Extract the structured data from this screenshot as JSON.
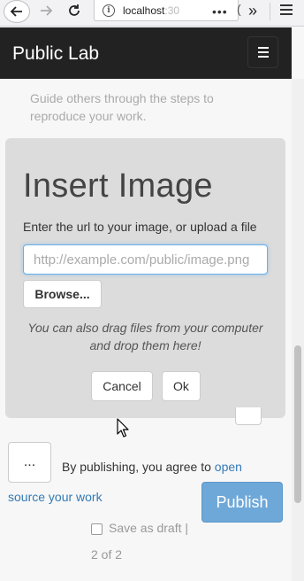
{
  "browser": {
    "url_visible": "localhost",
    "url_faded": ":30",
    "dots": "•••",
    "overflow": "»"
  },
  "header": {
    "brand": "Public Lab"
  },
  "page": {
    "guide_text": "Guide others through the steps to reproduce your work."
  },
  "modal": {
    "title": "Insert Image",
    "prompt": "Enter the url to your image, or upload a file",
    "url_placeholder": "http://example.com/public/image.png",
    "browse_label": "Browse...",
    "drag_hint": "You can also drag files from your computer and drop them here!",
    "cancel_label": "Cancel",
    "ok_label": "Ok"
  },
  "footer": {
    "more_label": "...",
    "agree_prefix": "By publishing, you agree to",
    "agree_link": "open source your work",
    "publish_label": "Publish",
    "save_draft_label": "Save as draft |",
    "page_count": "2 of 2"
  },
  "icons": {
    "back": "back-arrow-icon",
    "forward": "forward-arrow-icon",
    "reload": "reload-icon",
    "info": "info-icon",
    "menu": "hamburger-menu-icon"
  },
  "colors": {
    "header_bg": "#222222",
    "link": "#337ab7",
    "publish_bg": "#6ea8d8",
    "modal_bg": "#dcdcdc"
  }
}
